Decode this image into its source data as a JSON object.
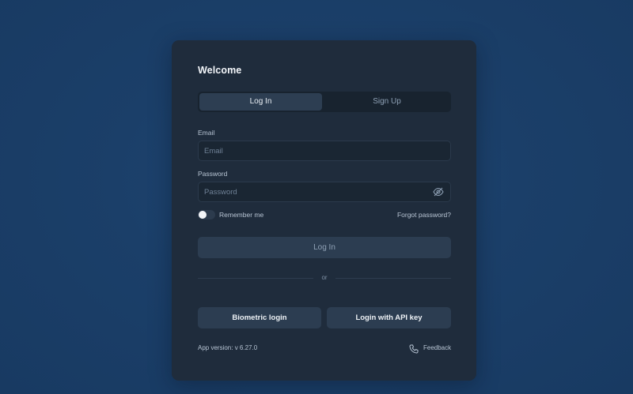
{
  "card": {
    "title": "Welcome"
  },
  "tabs": [
    {
      "label": "Log In",
      "active": true
    },
    {
      "label": "Sign Up",
      "active": false
    }
  ],
  "email": {
    "label": "Email",
    "placeholder": "Email",
    "value": ""
  },
  "password": {
    "label": "Password",
    "placeholder": "Password",
    "value": "",
    "toggle_icon": "eye-off-icon"
  },
  "remember": {
    "label": "Remember me",
    "checked": false
  },
  "forgot_label": "Forgot password?",
  "login_button": "Log In",
  "divider": "or",
  "alt_login": {
    "biometric_label": "Biometric login",
    "api_key_label": "Login with API key"
  },
  "footer": {
    "version": "App version: v 6.27.0",
    "feedback_label": "Feedback",
    "feedback_icon": "phone-icon"
  },
  "colors": {
    "background": "#1b3f69",
    "card": "#1f2c3c",
    "button": "#2c3d51",
    "active_tab": "#2d3e52"
  }
}
